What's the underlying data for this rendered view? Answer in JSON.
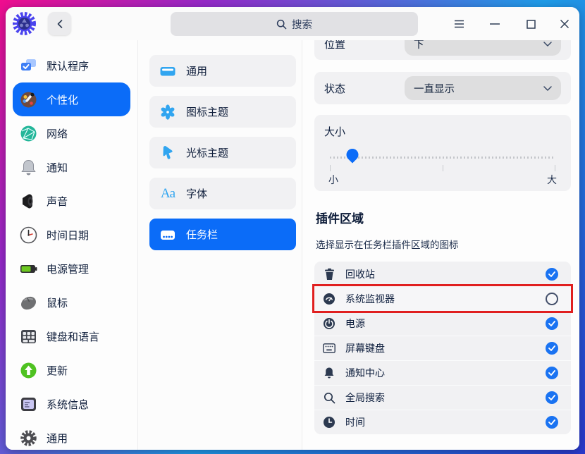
{
  "titlebar": {
    "search_placeholder": "搜索"
  },
  "sidebar": {
    "items": [
      {
        "label": "默认程序",
        "selected": false
      },
      {
        "label": "个性化",
        "selected": true
      },
      {
        "label": "网络",
        "selected": false
      },
      {
        "label": "通知",
        "selected": false
      },
      {
        "label": "声音",
        "selected": false
      },
      {
        "label": "时间日期",
        "selected": false
      },
      {
        "label": "电源管理",
        "selected": false
      },
      {
        "label": "鼠标",
        "selected": false
      },
      {
        "label": "键盘和语言",
        "selected": false
      },
      {
        "label": "更新",
        "selected": false
      },
      {
        "label": "系统信息",
        "selected": false
      },
      {
        "label": "通用",
        "selected": false
      }
    ]
  },
  "subnav": {
    "items": [
      {
        "label": "通用",
        "selected": false
      },
      {
        "label": "图标主题",
        "selected": false
      },
      {
        "label": "光标主题",
        "selected": false
      },
      {
        "label": "字体",
        "selected": false
      },
      {
        "label": "任务栏",
        "selected": true
      }
    ]
  },
  "taskbar_settings": {
    "position": {
      "label": "位置",
      "value": "下"
    },
    "status": {
      "label": "状态",
      "value": "一直显示"
    },
    "size": {
      "label": "大小",
      "min_label": "小",
      "max_label": "大",
      "value_percent": 10
    }
  },
  "plugin_area": {
    "title": "插件区域",
    "subtitle": "选择显示在任务栏插件区域的图标",
    "items": [
      {
        "label": "回收站",
        "checked": true,
        "highlighted": false
      },
      {
        "label": "系统监视器",
        "checked": false,
        "highlighted": true
      },
      {
        "label": "电源",
        "checked": true,
        "highlighted": false
      },
      {
        "label": "屏幕键盘",
        "checked": true,
        "highlighted": false
      },
      {
        "label": "通知中心",
        "checked": true,
        "highlighted": false
      },
      {
        "label": "全局搜索",
        "checked": true,
        "highlighted": false
      },
      {
        "label": "时间",
        "checked": true,
        "highlighted": false
      }
    ]
  },
  "colors": {
    "accent_blue": "#0b6cf8",
    "check_blue": "#1a73f2",
    "highlight_red": "#e01f1f",
    "subnav_icon_blue": "#31a5f0"
  }
}
